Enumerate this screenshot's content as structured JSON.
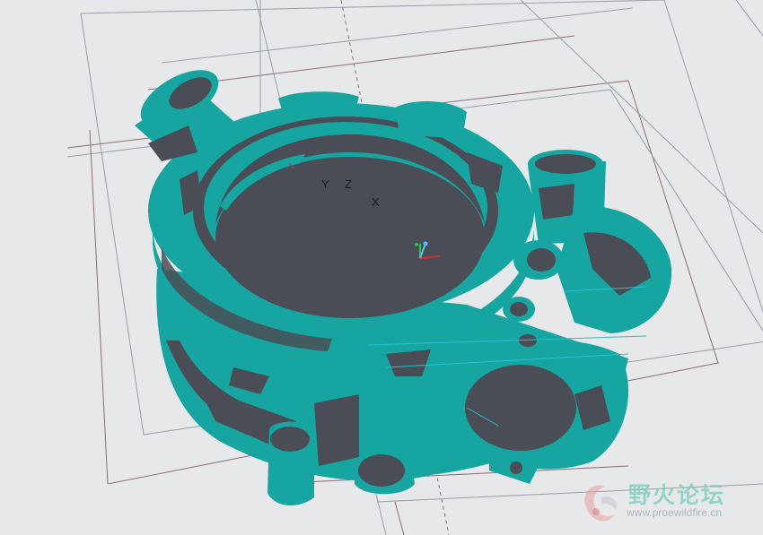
{
  "viewport": {
    "background": "#e6e8ea",
    "model_colors": {
      "deviation_surface": "#16a5a0",
      "base_surface": "#4a4d55",
      "datum_plane_lines": "#8d6d77",
      "datum_plane_lines_alt": "#9a9ea8",
      "accent_lines": "#23c3d6"
    }
  },
  "csys": {
    "label_y": "Y",
    "label_z": "Z",
    "label_x": "X"
  },
  "watermark": {
    "title": "野火论坛",
    "url": "www.proewildfire.cn",
    "logo_icon": "wildfire-logo-icon"
  }
}
